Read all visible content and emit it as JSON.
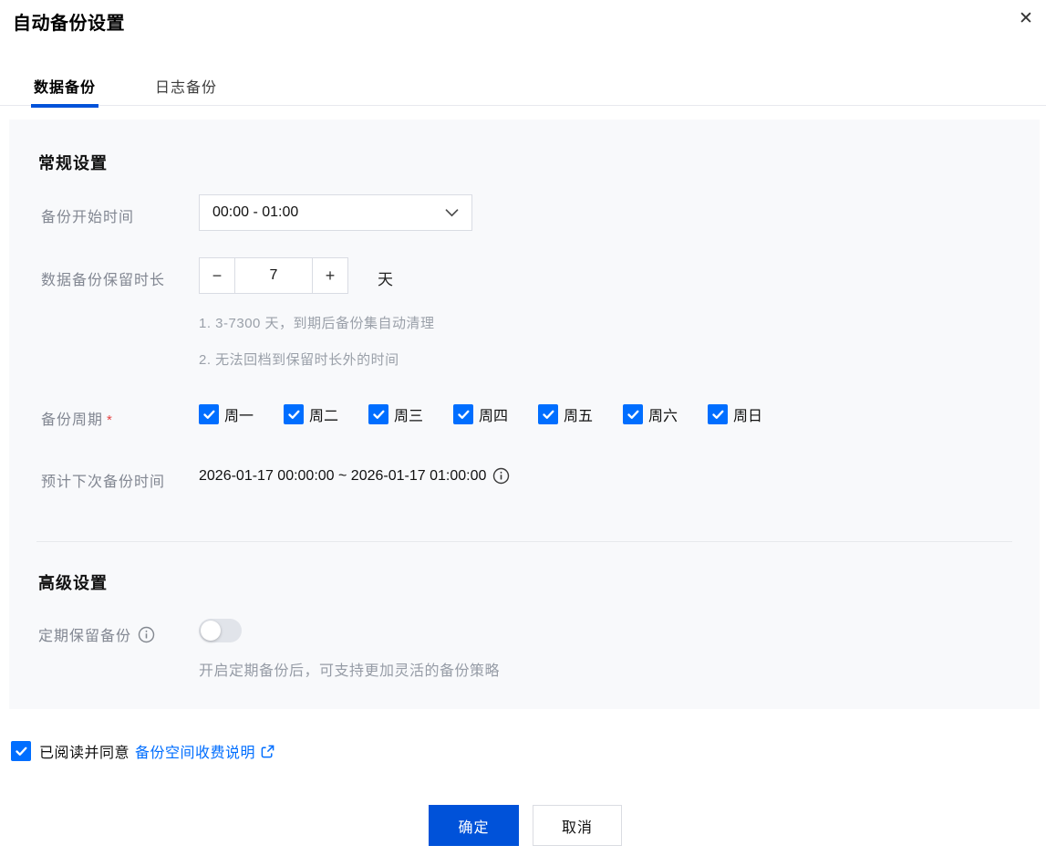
{
  "dialog": {
    "title": "自动备份设置"
  },
  "icons": {
    "close": "✕",
    "minus": "−",
    "plus": "+"
  },
  "tabs": [
    {
      "label": "数据备份",
      "active": true
    },
    {
      "label": "日志备份",
      "active": false
    }
  ],
  "general": {
    "heading": "常规设置",
    "backup_start_time": {
      "label": "备份开始时间",
      "value": "00:00 - 01:00"
    },
    "retention": {
      "label": "数据备份保留时长",
      "value": "7",
      "unit": "天",
      "hints": [
        "1. 3-7300 天，到期后备份集自动清理",
        "2. 无法回档到保留时长外的时间"
      ]
    },
    "backup_cycle": {
      "label": "备份周期",
      "required_mark": "*",
      "days": [
        "周一",
        "周二",
        "周三",
        "周四",
        "周五",
        "周六",
        "周日"
      ],
      "all_checked": true
    },
    "next_backup": {
      "label": "预计下次备份时间",
      "value": "2026-01-17 00:00:00 ~ 2026-01-17 01:00:00"
    }
  },
  "advanced": {
    "heading": "高级设置",
    "periodic_retention": {
      "label": "定期保留备份",
      "enabled": false,
      "hint": "开启定期备份后，可支持更加灵活的备份策略"
    }
  },
  "agreement": {
    "checked": true,
    "text": "已阅读并同意",
    "link": "备份空间收费说明"
  },
  "footer": {
    "confirm": "确定",
    "cancel": "取消"
  },
  "colors": {
    "primary_button": "#0052d9",
    "checkbox": "#006eff",
    "link": "#006eff",
    "panel_bg": "#f8f9fb"
  }
}
